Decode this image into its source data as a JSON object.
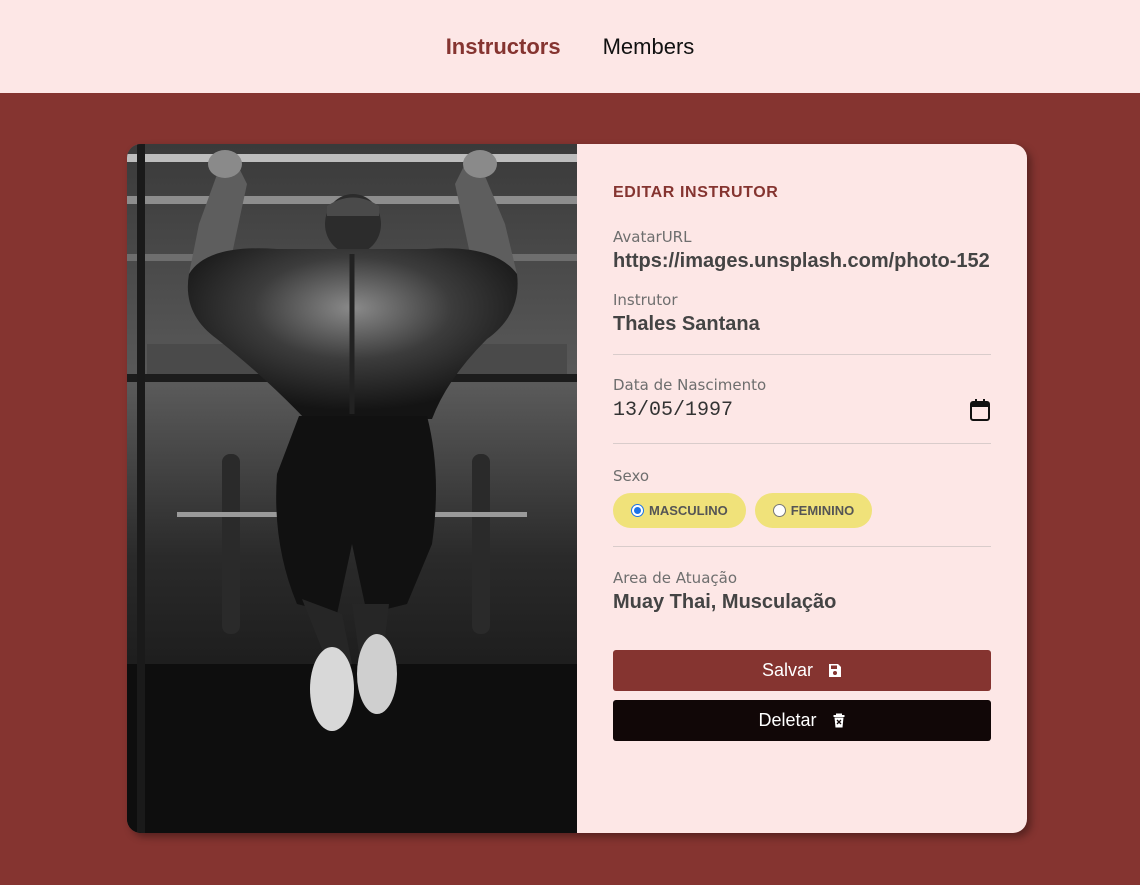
{
  "nav": {
    "instructors_label": "Instructors",
    "members_label": "Members"
  },
  "form": {
    "title": "EDITAR INSTRUTOR",
    "avatar": {
      "label": "AvatarURL",
      "value": "https://images.unsplash.com/photo-152"
    },
    "name": {
      "label": "Instrutor",
      "value": "Thales Santana"
    },
    "birth": {
      "label": "Data de Nascimento",
      "value": "13/05/1997"
    },
    "gender": {
      "label": "Sexo",
      "options": [
        {
          "label": "MASCULINO",
          "checked": true
        },
        {
          "label": "FEMININO",
          "checked": false
        }
      ]
    },
    "services": {
      "label": "Area de Atuação",
      "value": "Muay Thai, Musculação"
    },
    "save_label": "Salvar",
    "delete_label": "Deletar"
  },
  "colors": {
    "brand": "#853430",
    "header_bg": "#fde7e6",
    "pill": "#f0e27a",
    "delete": "#110707"
  }
}
